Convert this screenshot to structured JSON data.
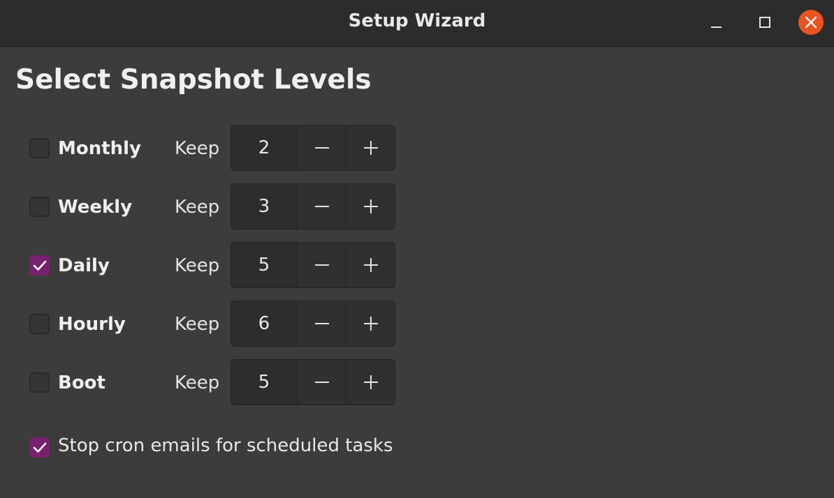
{
  "window": {
    "title": "Setup Wizard",
    "controls": {
      "minimize": "minimize-icon",
      "maximize": "maximize-icon",
      "close": "close-icon"
    },
    "close_color": "#e95420"
  },
  "page": {
    "heading": "Select Snapshot Levels"
  },
  "accent_color": "#77216f",
  "levels": [
    {
      "label": "Monthly",
      "checked": false,
      "keep_label": "Keep",
      "value": "2"
    },
    {
      "label": "Weekly",
      "checked": false,
      "keep_label": "Keep",
      "value": "3"
    },
    {
      "label": "Daily",
      "checked": true,
      "keep_label": "Keep",
      "value": "5"
    },
    {
      "label": "Hourly",
      "checked": false,
      "keep_label": "Keep",
      "value": "6"
    },
    {
      "label": "Boot",
      "checked": false,
      "keep_label": "Keep",
      "value": "5"
    }
  ],
  "stepper_icons": {
    "decrement": "minus-icon",
    "increment": "plus-icon"
  },
  "cron_option": {
    "label": "Stop cron emails for scheduled tasks",
    "checked": true
  }
}
